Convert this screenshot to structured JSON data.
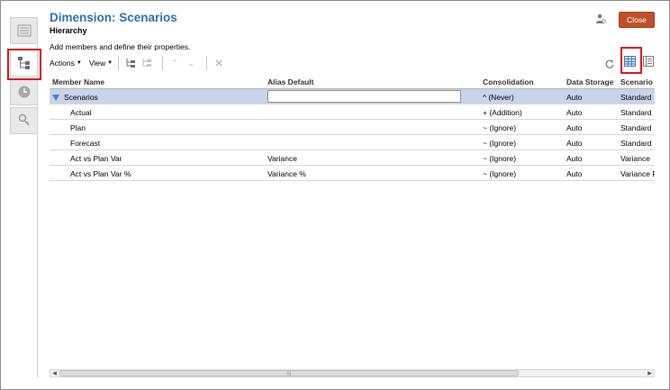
{
  "header": {
    "title": "Dimension: Scenarios",
    "subtitle": "Hierarchy",
    "instructions": "Add members and define their properties.",
    "close_label": "Close"
  },
  "toolbar": {
    "actions_label": "Actions",
    "view_label": "View"
  },
  "rail": {
    "tabs": [
      "list-tab",
      "hierarchy-tab",
      "history-tab",
      "security-tab"
    ],
    "active": "hierarchy-tab"
  },
  "table": {
    "columns": [
      "Member Name",
      "Alias Default",
      "Consolidation",
      "Data Storage",
      "Scenario"
    ],
    "rows": [
      {
        "member": "Scenarios",
        "alias": "",
        "consolidation": "^ (Never)",
        "storage": "Auto",
        "scenario": "Standard"
      },
      {
        "member": "Actual",
        "alias": "",
        "consolidation": "+ (Addition)",
        "storage": "Auto",
        "scenario": "Standard"
      },
      {
        "member": "Plan",
        "alias": "",
        "consolidation": "~ (Ignore)",
        "storage": "Auto",
        "scenario": "Standard"
      },
      {
        "member": "Forecast",
        "alias": "",
        "consolidation": "~ (Ignore)",
        "storage": "Auto",
        "scenario": "Standard"
      },
      {
        "member": "Act vs Plan Var",
        "alias": "Variance",
        "consolidation": "~ (Ignore)",
        "storage": "Auto",
        "scenario": "Variance"
      },
      {
        "member": "Act vs Plan Var %",
        "alias": "Variance %",
        "consolidation": "~ (Ignore)",
        "storage": "Auto",
        "scenario": "Variance P"
      }
    ]
  },
  "colors": {
    "title": "#2e6fa8",
    "close_button": "#c0502a",
    "selected_row": "#c9d3ea",
    "highlight": "#d9151c"
  }
}
